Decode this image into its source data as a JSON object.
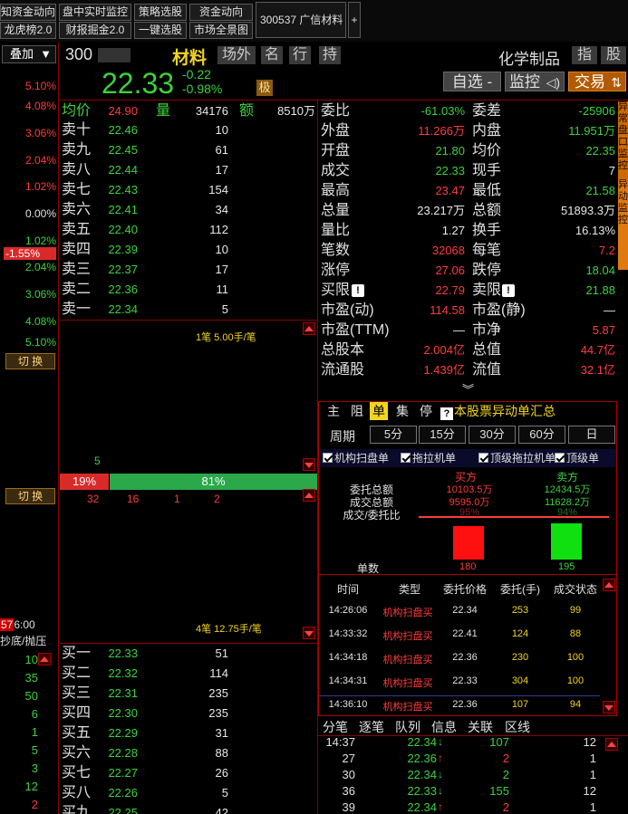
{
  "toolbar": {
    "row1": [
      "知资金动向",
      "盘中实时监控",
      "策略选股",
      "资金动向"
    ],
    "row2": [
      "龙虎榜2.0",
      "财报掘金2.0",
      "一键选股",
      "市场全景图"
    ],
    "tab": "300537 广信材料",
    "plus": "+"
  },
  "left": {
    "dropdown": "叠加",
    "pcts": [
      "5.10%",
      "4.08%",
      "3.06%",
      "2.04%",
      "1.02%",
      "0.00%",
      "1.02%",
      "-1.55%",
      "2.04%",
      "3.06%",
      "4.08%",
      "5.10%"
    ],
    "switch1": "切 换",
    "switch2": "切 换",
    "time": "57 6:00",
    "label": "抄底/抛压",
    "ticks": [
      "10",
      "35",
      "50",
      "6",
      "1",
      "5",
      "3",
      "12",
      "2"
    ]
  },
  "header": {
    "code": "300",
    "name": "材料",
    "chips": [
      "场外",
      "名",
      "行",
      "持"
    ],
    "industry": "化学制品",
    "chip_right": [
      "指",
      "股"
    ],
    "price": "22.33",
    "change": "-0.22",
    "change_pct": "-0.98%",
    "ji": "极",
    "btn_watch": "自选 -",
    "btn_monitor": "监控",
    "btn_trade": "交易"
  },
  "avg": {
    "label1": "均价",
    "v1": "24.90",
    "label2": "量",
    "v2": "34176",
    "label3": "额",
    "v3": "8510万"
  },
  "asks": [
    {
      "label": "卖十",
      "price": "22.46",
      "vol": "10"
    },
    {
      "label": "卖九",
      "price": "22.45",
      "vol": "61"
    },
    {
      "label": "卖八",
      "price": "22.44",
      "vol": "17"
    },
    {
      "label": "卖七",
      "price": "22.43",
      "vol": "154"
    },
    {
      "label": "卖六",
      "price": "22.41",
      "vol": "34"
    },
    {
      "label": "卖五",
      "price": "22.40",
      "vol": "112"
    },
    {
      "label": "卖四",
      "price": "22.39",
      "vol": "10"
    },
    {
      "label": "卖三",
      "price": "22.37",
      "vol": "17"
    },
    {
      "label": "卖二",
      "price": "22.36",
      "vol": "11"
    },
    {
      "label": "卖一",
      "price": "22.34",
      "vol": "5"
    }
  ],
  "mid": {
    "top_note": "1笔 5.00手/笔",
    "five": "5",
    "bar_left": "19%",
    "bar_right": "81%",
    "nums": [
      "32",
      "16",
      "1",
      "2"
    ],
    "bottom_note": "4笔 12.75手/笔"
  },
  "bids": [
    {
      "label": "买一",
      "price": "22.33",
      "vol": "51"
    },
    {
      "label": "买二",
      "price": "22.32",
      "vol": "114"
    },
    {
      "label": "买三",
      "price": "22.31",
      "vol": "235"
    },
    {
      "label": "买四",
      "price": "22.30",
      "vol": "235"
    },
    {
      "label": "买五",
      "price": "22.29",
      "vol": "31"
    },
    {
      "label": "买六",
      "price": "22.28",
      "vol": "88"
    },
    {
      "label": "买七",
      "price": "22.27",
      "vol": "26"
    },
    {
      "label": "买八",
      "price": "22.26",
      "vol": "5"
    },
    {
      "label": "买九",
      "price": "22.25",
      "vol": "42"
    }
  ],
  "info": [
    {
      "l1": "委比",
      "v1": "-61.03%",
      "c1": "green",
      "l2": "委差",
      "v2": "-25906",
      "c2": "green"
    },
    {
      "l1": "外盘",
      "v1": "11.266万",
      "c1": "red",
      "l2": "内盘",
      "v2": "11.951万",
      "c2": "green"
    },
    {
      "l1": "开盘",
      "v1": "21.80",
      "c1": "green",
      "l2": "均价",
      "v2": "22.35",
      "c2": "green"
    },
    {
      "l1": "成交",
      "v1": "22.33",
      "c1": "green",
      "l2": "现手",
      "v2": "7",
      "c2": "white"
    },
    {
      "l1": "最高",
      "v1": "23.47",
      "c1": "red",
      "l2": "最低",
      "v2": "21.58",
      "c2": "green"
    },
    {
      "l1": "总量",
      "v1": "23.217万",
      "c1": "white",
      "l2": "总额",
      "v2": "51893.3万",
      "c2": "white"
    },
    {
      "l1": "量比",
      "v1": "1.27",
      "c1": "white",
      "l2": "换手",
      "v2": "16.13%",
      "c2": "white"
    },
    {
      "l1": "笔数",
      "v1": "32068",
      "c1": "red",
      "l2": "每笔",
      "v2": "7.2",
      "c2": "red"
    },
    {
      "l1": "涨停",
      "v1": "27.06",
      "c1": "red",
      "l2": "跌停",
      "v2": "18.04",
      "c2": "green"
    },
    {
      "l1": "买限",
      "v1": "22.79",
      "c1": "red",
      "l2": "卖限",
      "v2": "21.88",
      "c2": "green"
    },
    {
      "l1": "市盈(动)",
      "v1": "114.58",
      "c1": "red",
      "l2": "市盈(静)",
      "v2": "—",
      "c2": "white"
    },
    {
      "l1": "市盈(TTM)",
      "v1": "—",
      "c1": "white",
      "l2": "市净",
      "v2": "5.87",
      "c2": "red"
    },
    {
      "l1": "总股本",
      "v1": "2.004亿",
      "c1": "red",
      "l2": "总值",
      "v2": "44.7亿",
      "c2": "red"
    },
    {
      "l1": "流通股",
      "v1": "1.439亿",
      "c1": "red",
      "l2": "流值",
      "v2": "32.1亿",
      "c2": "red"
    }
  ],
  "panel": {
    "tabs": [
      "主",
      "阻",
      "单",
      "集",
      "停"
    ],
    "title": "本股票异动单汇总",
    "period_label": "周期",
    "periods": [
      "5分",
      "15分",
      "30分",
      "60分",
      "日"
    ],
    "checks": [
      "机构扫盘单",
      "拖拉机单",
      "顶级拖拉机单",
      "顶级单"
    ],
    "buy_head": "买方",
    "sell_head": "卖方",
    "summary": [
      {
        "label": "委托总额",
        "buy": "10103.5万",
        "sell": "12434.5万"
      },
      {
        "label": "成交总额",
        "buy": "9595.0万",
        "sell": "11628.2万"
      },
      {
        "label": "成交/委托比",
        "buy": "95%",
        "sell": "94%"
      }
    ],
    "count_label": "单数",
    "buy_count": "180",
    "sell_count": "195",
    "table_head": [
      "时间",
      "类型",
      "委托价格",
      "委托(手)",
      "成交状态"
    ],
    "rows": [
      {
        "time": "14:26:06",
        "type": "机构扫盘买",
        "price": "22.34",
        "qty": "253",
        "status": "99"
      },
      {
        "time": "14:33:32",
        "type": "机构扫盘买",
        "price": "22.41",
        "qty": "124",
        "status": "88"
      },
      {
        "time": "14:34:18",
        "type": "机构扫盘买",
        "price": "22.36",
        "qty": "230",
        "status": "100"
      },
      {
        "time": "14:34:31",
        "type": "机构扫盘买",
        "price": "22.33",
        "qty": "304",
        "status": "100"
      },
      {
        "time": "14:36:10",
        "type": "机构扫盘买",
        "price": "22.36",
        "qty": "107",
        "status": "94"
      }
    ]
  },
  "bottom": {
    "tabs": [
      "分笔",
      "逐笔",
      "队列",
      "信息",
      "关联",
      "区线"
    ],
    "ticks": [
      {
        "time": "14:37",
        "price": "22.34",
        "dir": "↓",
        "vol": "107",
        "n": "12",
        "pc": "green",
        "vc": "green"
      },
      {
        "time": "27",
        "price": "22.36",
        "dir": "↑",
        "vol": "2",
        "n": "1",
        "pc": "green",
        "vc": "red"
      },
      {
        "time": "30",
        "price": "22.34",
        "dir": "↓",
        "vol": "2",
        "n": "1",
        "pc": "green",
        "vc": "green"
      },
      {
        "time": "36",
        "price": "22.33",
        "dir": "↓",
        "vol": "155",
        "n": "12",
        "pc": "green",
        "vc": "green"
      },
      {
        "time": "39",
        "price": "22.34",
        "dir": "↑",
        "vol": "2",
        "n": "1",
        "pc": "green",
        "vc": "red"
      }
    ]
  },
  "side": {
    "text": "异常盘口监控",
    "text2": "异动监控"
  },
  "colors": {
    "red": "#ff3b3b",
    "green": "#3cd13c",
    "accent": "#f3d51e",
    "border": "#8b0000"
  }
}
